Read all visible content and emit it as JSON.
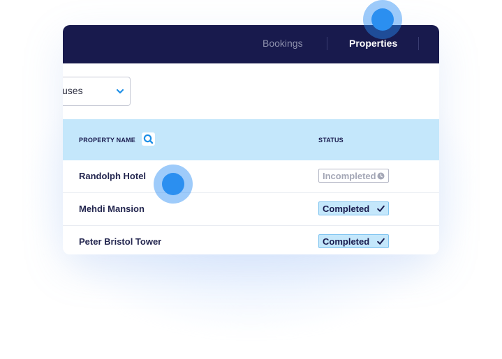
{
  "nav": {
    "tabs": [
      {
        "label": "Bookings",
        "active": false
      },
      {
        "label": "Properties",
        "active": true
      }
    ]
  },
  "filter": {
    "selected_value": "uses",
    "icon": "chevron-down-icon"
  },
  "table": {
    "headers": {
      "name": "PROPERTY NAME",
      "status": "STATUS"
    },
    "rows": [
      {
        "name": "Randolph Hotel",
        "status": "Incompleted",
        "status_icon": "clock-icon"
      },
      {
        "name": "Mehdi Mansion",
        "status": "Completed",
        "status_icon": "check-icon"
      },
      {
        "name": "Peter Bristol Tower",
        "status": "Completed",
        "status_icon": "check-icon"
      }
    ]
  },
  "colors": {
    "nav_background": "#181a4d",
    "header_background": "#c4e7fb",
    "accent": "#2b8ff0",
    "completed_badge": "#c4e7fb",
    "incompleted_text": "#a4a7b6"
  }
}
